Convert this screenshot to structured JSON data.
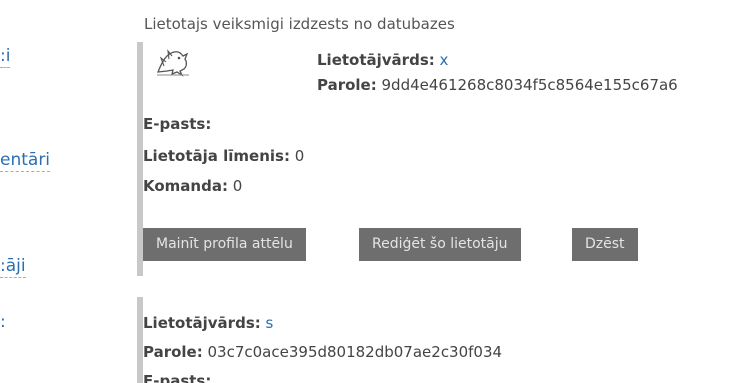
{
  "sidebar": {
    "items": [
      {
        "label": ":i"
      },
      {
        "label": "entāri"
      },
      {
        "label": ":āji"
      },
      {
        "label": ":"
      }
    ]
  },
  "flash_message": "Lietotajs veiksmigi izdzests no datubazes",
  "labels": {
    "username": "Lietotājvārds:",
    "password": "Parole:",
    "email": "E-pasts:",
    "level": "Lietotāja līmenis:",
    "team": "Komanda:"
  },
  "users": [
    {
      "avatar_icon": "dragon-icon",
      "username": "x",
      "password": "9dd4e461268c8034f5c8564e155c67a6",
      "email": "",
      "level": "0",
      "team": "0",
      "buttons": {
        "change_avatar": "Mainīt profila attēlu",
        "edit": "Rediģēt šo lietotāju",
        "delete": "Dzēst"
      }
    },
    {
      "username": "s",
      "password": "03c7c0ace395d80182db07ae2c30f034"
    }
  ],
  "colors": {
    "link": "#2a6fb3",
    "button_bg": "#6e6e6e",
    "card_border": "#c8c8c8"
  }
}
